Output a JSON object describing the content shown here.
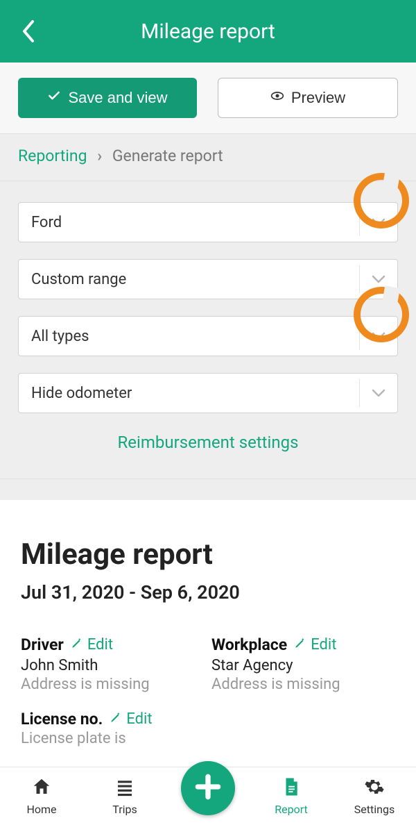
{
  "header": {
    "title": "Mileage report"
  },
  "actions": {
    "save_label": "Save and view",
    "preview_label": "Preview"
  },
  "breadcrumb": {
    "root": "Reporting",
    "current": "Generate report"
  },
  "filters": {
    "vehicle": "Ford",
    "range": "Custom range",
    "types": "All types",
    "odometer": "Hide odometer"
  },
  "reimbursement_link": "Reimbursement settings",
  "report": {
    "title": "Mileage report",
    "date_range": "Jul 31, 2020 - Sep 6, 2020",
    "driver": {
      "label": "Driver",
      "value": "John Smith",
      "missing": "Address is missing",
      "edit": "Edit"
    },
    "workplace": {
      "label": "Workplace",
      "value": "Star Agency",
      "missing": "Address is missing",
      "edit": "Edit"
    },
    "license": {
      "label": "License no.",
      "missing": "License plate is",
      "edit": "Edit"
    }
  },
  "nav": {
    "home": "Home",
    "trips": "Trips",
    "report": "Report",
    "settings": "Settings"
  }
}
